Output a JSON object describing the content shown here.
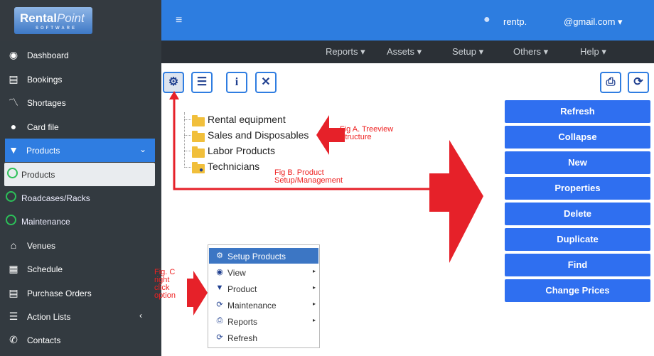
{
  "brand": {
    "name_a": "Rental",
    "name_b": "Point",
    "tagline": "SOFTWARE"
  },
  "sidebar": {
    "items": [
      {
        "label": "Dashboard",
        "icon": "dashboard-icon"
      },
      {
        "label": "Bookings",
        "icon": "book-icon"
      },
      {
        "label": "Shortages",
        "icon": "chart-icon"
      },
      {
        "label": "Card file",
        "icon": "user-icon"
      },
      {
        "label": "Products",
        "icon": "cart-icon"
      },
      {
        "label": "Products",
        "icon": "circle-icon"
      },
      {
        "label": "Roadcases/Racks",
        "icon": "circle-icon"
      },
      {
        "label": "Maintenance",
        "icon": "circle-icon"
      },
      {
        "label": "Venues",
        "icon": "building-icon"
      },
      {
        "label": "Schedule",
        "icon": "calendar-icon"
      },
      {
        "label": "Purchase Orders",
        "icon": "list-icon"
      },
      {
        "label": "Action Lists",
        "icon": "tasks-icon"
      },
      {
        "label": "Contacts",
        "icon": "phone-icon"
      }
    ]
  },
  "header": {
    "user": "rentp.",
    "email": "@gmail.com ▾",
    "menu_glyph": "≡"
  },
  "menubar": [
    "Reports ▾",
    "Assets ▾",
    "Setup ▾",
    "Others ▾",
    "Help ▾"
  ],
  "tree": [
    "Rental equipment",
    "Sales and Disposables",
    "Labor Products",
    "Technicians"
  ],
  "actions": [
    "Refresh",
    "Collapse",
    "New",
    "Properties",
    "Delete",
    "Duplicate",
    "Find",
    "Change Prices"
  ],
  "annotations": {
    "fig_a": [
      "Fig A. Treeview",
      "Structure"
    ],
    "fig_b": [
      "Fig B. Product",
      "Setup/Management"
    ],
    "fig_c": [
      "Fig. C",
      "right",
      "click",
      "option"
    ]
  },
  "context_menu": {
    "header": "Setup Products",
    "items": [
      "View",
      "Product",
      "Maintenance",
      "Reports",
      "Refresh"
    ]
  },
  "colors": {
    "accent": "#2f7de1",
    "sidebar": "#333a40",
    "button": "#2f6ff0",
    "annotation": "#e22222"
  }
}
